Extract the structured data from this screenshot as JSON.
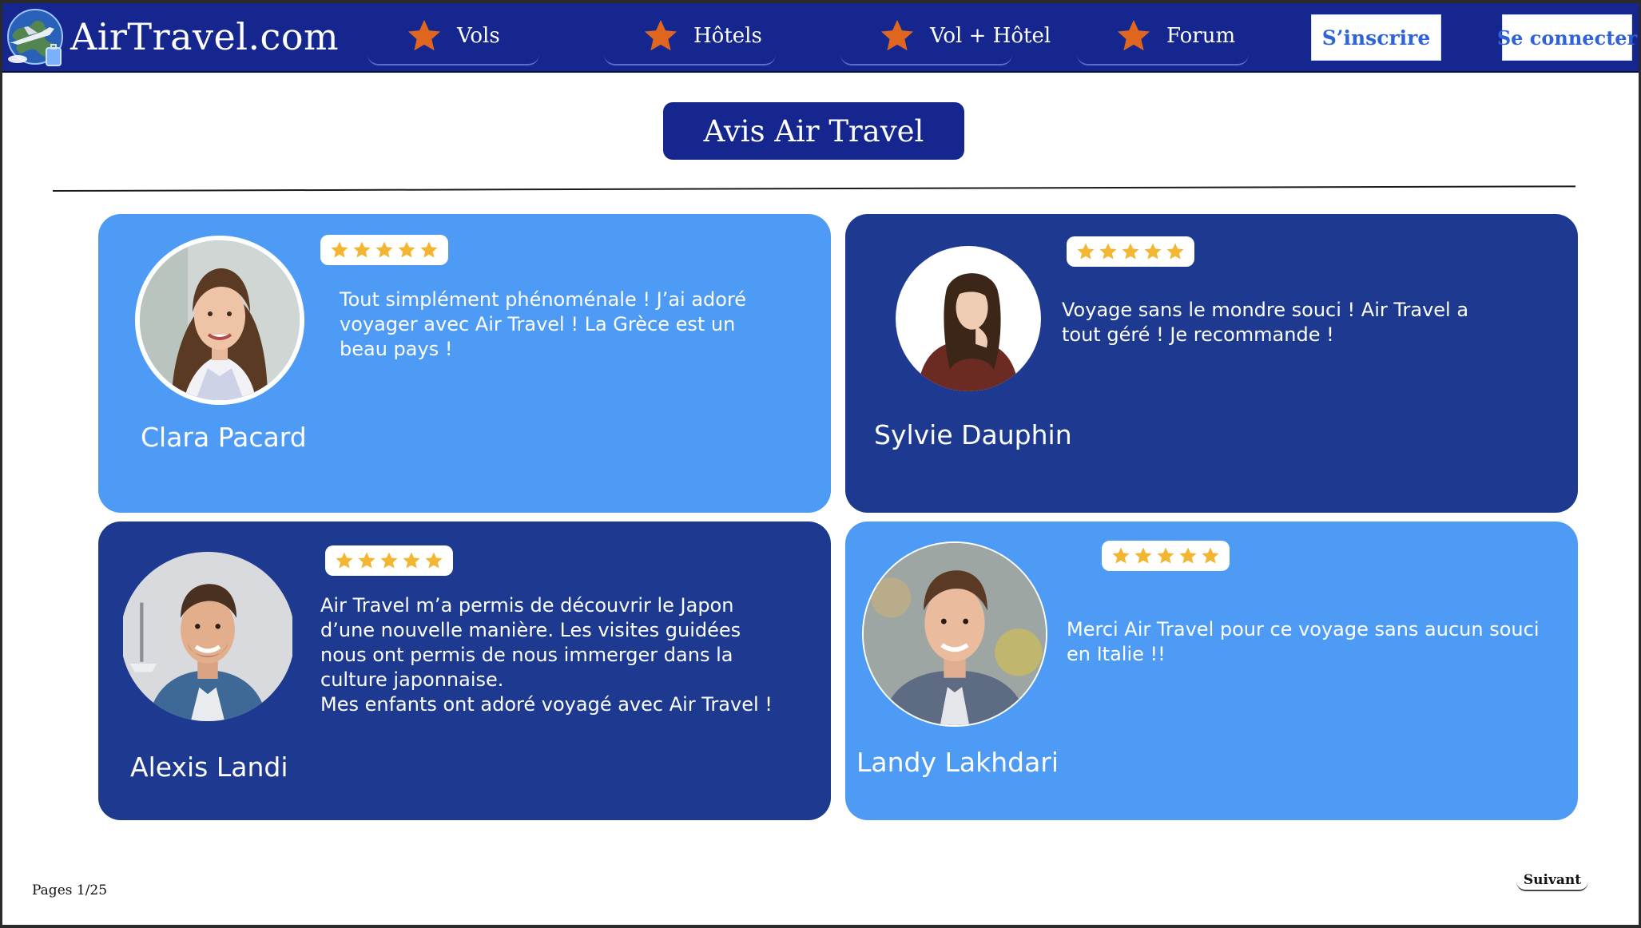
{
  "header": {
    "brand": "AirTravel.com",
    "logo_icon": "globe-plane-logo",
    "nav": [
      {
        "label": "Vols",
        "icon": "star-icon"
      },
      {
        "label": "Hôtels",
        "icon": "star-icon"
      },
      {
        "label": "Vol + Hôtel",
        "icon": "star-icon"
      },
      {
        "label": "Forum",
        "icon": "star-icon"
      }
    ],
    "signup_label": "S’inscrire",
    "login_label": "Se connecter"
  },
  "main": {
    "title": "Avis Air Travel",
    "reviews": [
      {
        "name": "Clara Pacard",
        "rating": 5,
        "text": [
          "Tout simplément phénoménale ! J’ai adoré",
          "voyager avec Air Travel ! La Grèce est un",
          "beau pays !"
        ],
        "theme": "light"
      },
      {
        "name": "Sylvie Dauphin",
        "rating": 5,
        "text": [
          "Voyage sans le mondre souci ! Air Travel a",
          "tout géré ! Je recommande !"
        ],
        "theme": "dark"
      },
      {
        "name": "Alexis Landi",
        "rating": 5,
        "text": [
          "Air Travel m’a permis de découvrir le Japon",
          "d’une nouvelle manière. Les visites guidées",
          "nous ont permis de nous immerger dans la",
          "culture japonnaise.",
          "Mes enfants ont adoré voyagé avec Air Travel !"
        ],
        "theme": "dark"
      },
      {
        "name": "Landy Lakhdari",
        "rating": 5,
        "text": [
          "Merci Air Travel pour ce voyage sans aucun souci",
          "en Italie !!"
        ],
        "theme": "light"
      }
    ]
  },
  "footer": {
    "pages_label": "Pages 1/25",
    "next_label": "Suivant"
  },
  "colors": {
    "header_bg": "#16268f",
    "card_light": "#4e9bf5",
    "card_dark": "#1d3a90",
    "nav_star": "#e0661f",
    "rating_star": "#f2b632",
    "button_text": "#2f64d6"
  }
}
